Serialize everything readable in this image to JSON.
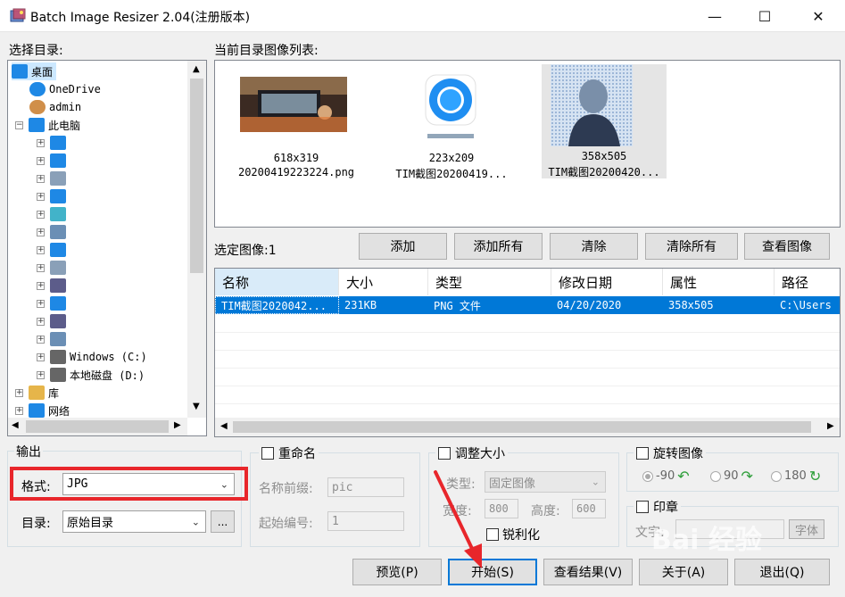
{
  "window": {
    "title": "Batch Image Resizer 2.04(注册版本)",
    "controls": {
      "minimize": "—",
      "maximize": "☐",
      "close": "✕"
    }
  },
  "dir_panel": {
    "label": "选择目录:",
    "tree": [
      {
        "label": "桌面",
        "icon": "desktop-icon"
      },
      {
        "label": "OneDrive",
        "icon": "cloud-icon"
      },
      {
        "label": "admin",
        "icon": "user-icon"
      },
      {
        "label": "此电脑",
        "icon": "computer-icon"
      },
      {
        "label": "",
        "icon": "downloads-icon"
      },
      {
        "label": "",
        "icon": "music-icon"
      },
      {
        "label": "",
        "icon": "document-icon"
      },
      {
        "label": "",
        "icon": "desktop-icon"
      },
      {
        "label": "",
        "icon": "3d-objects-icon"
      },
      {
        "label": "",
        "icon": "picture-icon"
      },
      {
        "label": "",
        "icon": "downloads-icon"
      },
      {
        "label": "",
        "icon": "document-icon"
      },
      {
        "label": "",
        "icon": "video-icon"
      },
      {
        "label": "",
        "icon": "music-icon"
      },
      {
        "label": "",
        "icon": "video-icon"
      },
      {
        "label": "",
        "icon": "picture-icon"
      },
      {
        "label": "Windows (C:)",
        "icon": "drive-icon"
      },
      {
        "label": "本地磁盘 (D:)",
        "icon": "drive-icon"
      },
      {
        "label": "库",
        "icon": "library-icon"
      },
      {
        "label": "网络",
        "icon": "network-icon"
      }
    ]
  },
  "image_list": {
    "label": "当前目录图像列表:",
    "thumbs": [
      {
        "size": "618x319",
        "name": "20200419223224.png"
      },
      {
        "size": "223x209",
        "name": "TIM截图20200419..."
      },
      {
        "size": "358x505",
        "name": "TIM截图20200420..."
      }
    ]
  },
  "selected": {
    "label": "选定图像:1",
    "buttons": [
      "添加",
      "添加所有",
      "清除",
      "清除所有",
      "查看图像"
    ],
    "columns": [
      "名称",
      "大小",
      "类型",
      "修改日期",
      "属性",
      "路径"
    ],
    "rows": [
      [
        "TIM截图2020042...",
        "231KB",
        "PNG 文件",
        "04/20/2020",
        "358x505",
        "C:\\Users"
      ]
    ]
  },
  "output": {
    "label": "输出",
    "format_label": "格式:",
    "format_value": "JPG",
    "dir_label": "目录:",
    "dir_value": "原始目录",
    "browse": "..."
  },
  "rename": {
    "label": "重命名",
    "prefix_label": "名称前缀:",
    "prefix_value": "pic",
    "start_label": "起始编号:",
    "start_value": "1"
  },
  "resize": {
    "label": "调整大小",
    "type_label": "类型:",
    "type_value": "固定图像",
    "width_label": "宽度:",
    "width_value": "800",
    "height_label": "高度:",
    "height_value": "600",
    "sharpen_label": "锐利化"
  },
  "rotate": {
    "label": "旋转图像",
    "options": [
      "-90",
      "90",
      "180"
    ]
  },
  "stamp": {
    "label": "印章",
    "text_label": "文字:",
    "font_button": "字体"
  },
  "bottom_buttons": {
    "preview": "预览(P)",
    "start": "开始(S)",
    "view_result": "查看结果(V)",
    "about": "关于(A)",
    "exit": "退出(Q)"
  },
  "colors": {
    "selection": "#0078d7",
    "highlight_box": "#e8262b",
    "arrow": "#e8262b",
    "header_hover": "#d9ebf9"
  }
}
